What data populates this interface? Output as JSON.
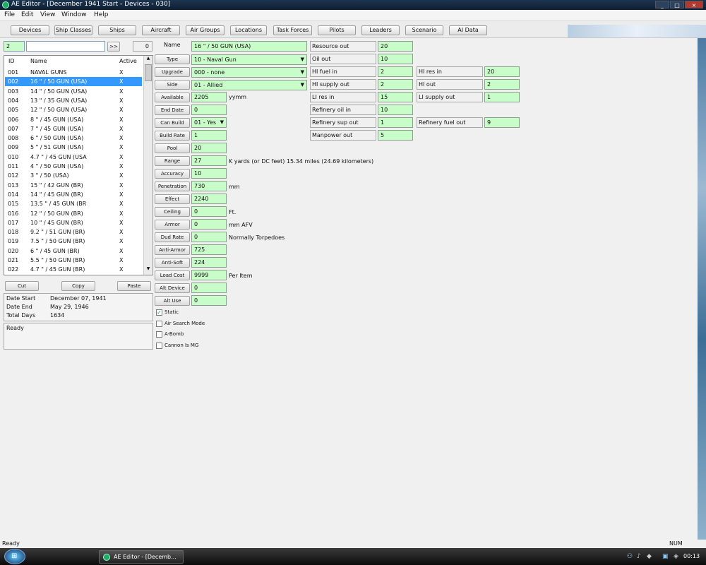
{
  "window": {
    "title": "AE Editor - [December 1941 Start - Devices - 030]",
    "controls": [
      "_",
      "□",
      "×"
    ]
  },
  "menu": [
    "File",
    "Edit",
    "View",
    "Window",
    "Help"
  ],
  "toolbar": [
    "Devices",
    "Ship Classes",
    "Ships",
    "Aircraft",
    "Air Groups",
    "Locations",
    "Task Forces",
    "Pilots",
    "Leaders",
    "Scenario",
    "AI Data"
  ],
  "search": {
    "index_value": "2",
    "text_value": "",
    "go_label": ">>",
    "count": "0"
  },
  "list": {
    "headers": {
      "id": "ID",
      "name": "Name",
      "active": "Active"
    },
    "rows": [
      {
        "id": "001",
        "name": "NAVAL GUNS",
        "active": "X"
      },
      {
        "id": "002",
        "name": "16 \" / 50 GUN (USA)",
        "active": "X"
      },
      {
        "id": "003",
        "name": "14 \" / 50 GUN (USA)",
        "active": "X"
      },
      {
        "id": "004",
        "name": "13 \" / 35 GUN (USA)",
        "active": "X"
      },
      {
        "id": "005",
        "name": "12 \" / 50 GUN (USA)",
        "active": "X"
      },
      {
        "id": "006",
        "name": "8 \" /  45 GUN (USA)",
        "active": "X"
      },
      {
        "id": "007",
        "name": "7 \" / 45 GUN (USA)",
        "active": "X"
      },
      {
        "id": "008",
        "name": "6 \" / 50 GUN (USA)",
        "active": "X"
      },
      {
        "id": "009",
        "name": "5 \" / 51 GUN (USA)",
        "active": "X"
      },
      {
        "id": "010",
        "name": "4.7 \" / 45 GUN (USA",
        "active": "X"
      },
      {
        "id": "011",
        "name": "4 \" / 50 GUN (USA)",
        "active": "X"
      },
      {
        "id": "012",
        "name": "3 \" /  50 (USA)",
        "active": "X"
      },
      {
        "id": "013",
        "name": "15 \" / 42 GUN (BR)",
        "active": "X"
      },
      {
        "id": "014",
        "name": "14 \" / 45 GUN (BR)",
        "active": "X"
      },
      {
        "id": "015",
        "name": "13.5 \" / 45 GUN (BR",
        "active": "X"
      },
      {
        "id": "016",
        "name": "12  \" / 50 GUN (BR)",
        "active": "X"
      },
      {
        "id": "017",
        "name": "10  \" / 45 GUN (BR)",
        "active": "X"
      },
      {
        "id": "018",
        "name": "9.2 \" / 51 GUN (BR)",
        "active": "X"
      },
      {
        "id": "019",
        "name": "7.5 \" / 50 GUN (BR)",
        "active": "X"
      },
      {
        "id": "020",
        "name": "6  \" / 45 GUN (BR)",
        "active": "X"
      },
      {
        "id": "021",
        "name": "5.5 \" / 50 GUN (BR)",
        "active": "X"
      },
      {
        "id": "022",
        "name": "4.7 \" / 45 GUN (BR)",
        "active": "X"
      }
    ]
  },
  "clipboard": {
    "cut": "Cut",
    "copy": "Copy",
    "paste": "Paste"
  },
  "dates": {
    "start_label": "Date Start",
    "start_value": "December 07, 1941",
    "end_label": "Date End",
    "end_value": "May 29, 1946",
    "total_label": "Total Days",
    "total_value": "1634"
  },
  "status_box": "Ready",
  "fields": {
    "name": {
      "label": "Name",
      "value": "16 \" / 50 GUN (USA)"
    },
    "type": {
      "label": "Type",
      "value": "10 - Naval Gun"
    },
    "upgrade": {
      "label": "Upgrade",
      "value": "000 - none"
    },
    "side": {
      "label": "Side",
      "value": "01 - Allied"
    },
    "available": {
      "label": "Available",
      "value": "2205",
      "unit": "yymm"
    },
    "end_date": {
      "label": "End Date",
      "value": "0"
    },
    "can_build": {
      "label": "Can Build",
      "value": "01 - Yes"
    },
    "build_rate": {
      "label": "Build Rate",
      "value": "1"
    },
    "pool": {
      "label": "Pool",
      "value": "20"
    },
    "range": {
      "label": "Range",
      "value": "27",
      "unit": "K yards  (or DC feet)  15.34 miles  (24.69 kilometers)"
    },
    "accuracy": {
      "label": "Accuracy",
      "value": "10"
    },
    "penetration": {
      "label": "Penetration",
      "value": "730",
      "unit": "mm"
    },
    "effect": {
      "label": "Effect",
      "value": "2240"
    },
    "ceiling": {
      "label": "Ceiling",
      "value": "0",
      "unit": "Ft."
    },
    "armor": {
      "label": "Armor",
      "value": "0",
      "unit": "mm AFV"
    },
    "dud_rate": {
      "label": "Dud Rate",
      "value": "0",
      "unit": "Normally Torpedoes"
    },
    "anti_armor": {
      "label": "Anti-Armor",
      "value": "725"
    },
    "anti_soft": {
      "label": "Anti-Soft",
      "value": "224"
    },
    "load_cost": {
      "label": "Load Cost",
      "value": "9999",
      "unit": "Per Item"
    },
    "alt_device": {
      "label": "Alt Device",
      "value": "0"
    },
    "alt_use": {
      "label": "Alt Use",
      "value": "0"
    }
  },
  "checkboxes": [
    {
      "label": "Static",
      "checked": true
    },
    {
      "label": "Air Search Mode",
      "checked": false
    },
    {
      "label": "A-Bomb",
      "checked": false
    },
    {
      "label": "Cannon Is MG",
      "checked": false
    }
  ],
  "resources": {
    "resource_out": {
      "label": "Resource out",
      "value": "20"
    },
    "oil_out": {
      "label": "Oil out",
      "value": "10"
    },
    "hi_fuel_in": {
      "label": "HI fuel in",
      "value": "2"
    },
    "hi_supply_out": {
      "label": "HI supply out",
      "value": "2"
    },
    "li_res_in": {
      "label": "LI res in",
      "value": "15"
    },
    "refinery_oil_in": {
      "label": "Refinery oil in",
      "value": "10"
    },
    "refinery_sup_out": {
      "label": "Refinery sup out",
      "value": "1"
    },
    "manpower_out": {
      "label": "Manpower out",
      "value": "5"
    },
    "hi_res_in": {
      "label": "HI res in",
      "value": "20"
    },
    "hi_out": {
      "label": "HI out",
      "value": "2"
    },
    "li_supply_out": {
      "label": "LI supply out",
      "value": "1"
    },
    "refinery_fuel_out": {
      "label": "Refinery fuel out",
      "value": "9"
    }
  },
  "statusbar": {
    "left": "Ready",
    "num": "NUM"
  },
  "taskbar": {
    "app": "AE Editor - [Decemb...",
    "clock": "00:13"
  },
  "colors": {
    "field_green": "#c8fcc8",
    "selection": "#3399ff"
  }
}
